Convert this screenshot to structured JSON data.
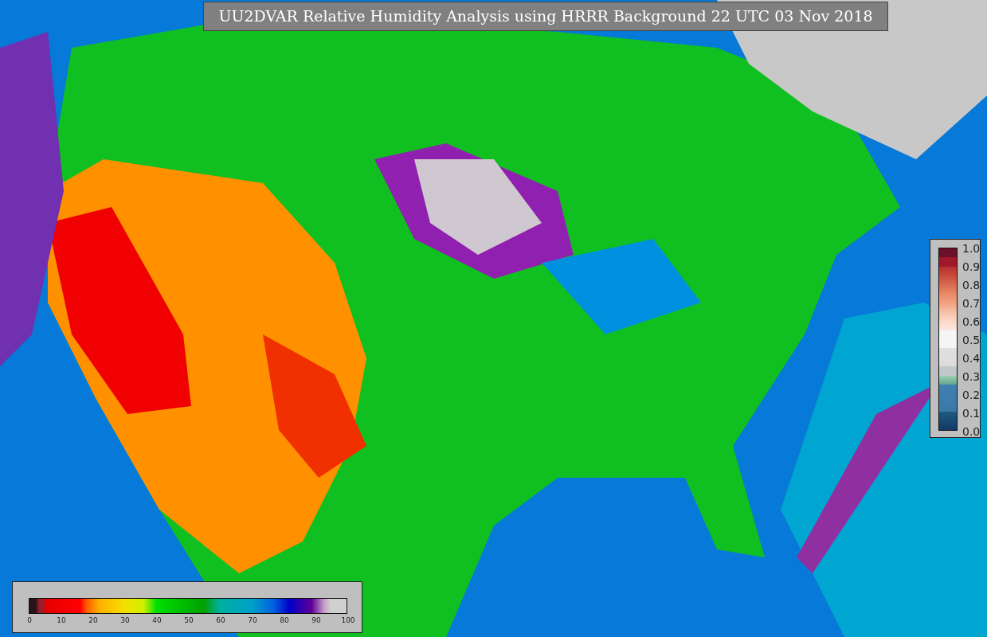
{
  "title": "UU2DVAR Relative Humidity Analysis using HRRR Background 22 UTC 03 Nov 2018",
  "humidity_colorbar": {
    "ticks": [
      "0",
      "10",
      "20",
      "30",
      "40",
      "50",
      "60",
      "70",
      "80",
      "90",
      "100"
    ]
  },
  "observation_colorbar": {
    "ticks": [
      "1.0",
      "0.9",
      "0.8",
      "0.7",
      "0.6",
      "0.5",
      "0.4",
      "0.3",
      "0.2",
      "0.1",
      "0.0"
    ]
  }
}
